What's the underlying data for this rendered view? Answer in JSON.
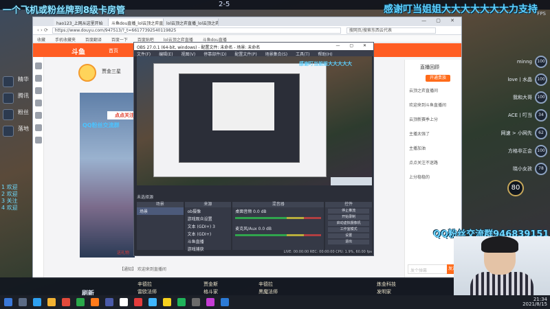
{
  "overlay": {
    "left_banner": "一个飞机或粉丝牌到8级卡房管",
    "right_banner": "感谢叮当姐姐大大大大大大大力支持",
    "qq_banner": "QQ粉丝交流群946839151",
    "score": "2-5",
    "fps": "FPS"
  },
  "browser": {
    "tabs": [
      "hao123_上网从这里开始",
      "斗鱼dou直播_lol云顶之弈直播",
      "lol云顶之弈直播_lol云顶之弈"
    ],
    "url": "https://www.douyu.com/947513/?_t=66177392540119825",
    "search_placeholder": "搜网页/搜索东西云代表",
    "bookmarks": [
      "收藏",
      "手机收藏夹",
      "百度翻译",
      "百度一下",
      "百度贴吧",
      "lol云顶之弈直播",
      "斗鱼dou直播"
    ],
    "site_logo": "斗鱼",
    "home_link": "首页",
    "streamer_name": "贾金三星",
    "follow_tag": "点点关注",
    "stream_banner": "QQ粉丝交流群",
    "gift_text": "送礼物",
    "notice": "【通知】 欢迎来到直播间",
    "right_header": "直播回顾",
    "right_button": "开通贵族",
    "chat_lines": [
      "云顶之弈直播间",
      "欢迎来到斗鱼直播间",
      "云顶新赛季上分",
      "主播太强了",
      "主播加油",
      "点点关注不迷路",
      "上分稳稳的"
    ],
    "send_placeholder": "发个弹幕",
    "send_button": "发送"
  },
  "obs": {
    "title": "OBS 27.0.1 (64-bit, windows) - 配置文件: 未命名 - 场景: 未命名",
    "menu": [
      "文件(F)",
      "编辑(E)",
      "视图(V)",
      "停靠部件(D)",
      "配置文件(P)",
      "场景集合(S)",
      "工具(T)",
      "帮助(H)"
    ],
    "preview_banner": "感谢叮当姐姐大大大大大",
    "scene_label": "未选择源",
    "docks": {
      "scenes_header": "场景",
      "scenes": [
        "场景"
      ],
      "sources_header": "来源",
      "sources": [
        "ob摄像",
        "游戏观众设置",
        "文本 (GDI+) 3",
        "文本 (GDI+)",
        "斗鱼直播",
        "游戏捕获"
      ],
      "mixer_header": "混音器",
      "mixer_channels": [
        "桌面音频",
        "麦克风/Aux"
      ],
      "mixer_levels": [
        "0.0 dB",
        "0.0 dB"
      ],
      "controls_header": "控件",
      "controls": [
        "停止推流",
        "开始录制",
        "启动虚拟摄像机",
        "工作室模式",
        "设置",
        "退出"
      ]
    },
    "status": "LIVE: 00:00:00   REC: 00:00:00   CPU: 1.9%, 60.00 fps"
  },
  "game": {
    "left_stats": [
      "精华",
      "腾讯",
      "粉丝",
      "落地"
    ],
    "chat": [
      "1 欢迎",
      "2 欢迎",
      "3 关注",
      "4 欢迎"
    ],
    "players": [
      {
        "name": "minng",
        "hp": "100"
      },
      {
        "name": "love丨水晶",
        "hp": "100"
      },
      {
        "name": "我和大哥",
        "hp": "100"
      },
      {
        "name": "ACE丨叮当",
        "hp": "34"
      },
      {
        "name": "网速 > 小网先",
        "hp": "62"
      },
      {
        "name": "方格非正会",
        "hp": "100"
      },
      {
        "name": "晓小女孩",
        "hp": "78"
      }
    ],
    "level": "80",
    "shop": [
      "辛德拉",
      "雷欧法师",
      "贾金斯",
      "格斗家",
      "辛德拉",
      "黑魔法师",
      "炼金科技",
      "发明家"
    ],
    "refresh": "刷新"
  },
  "taskbar": {
    "time": "21:34",
    "date": "2021/8/15"
  }
}
